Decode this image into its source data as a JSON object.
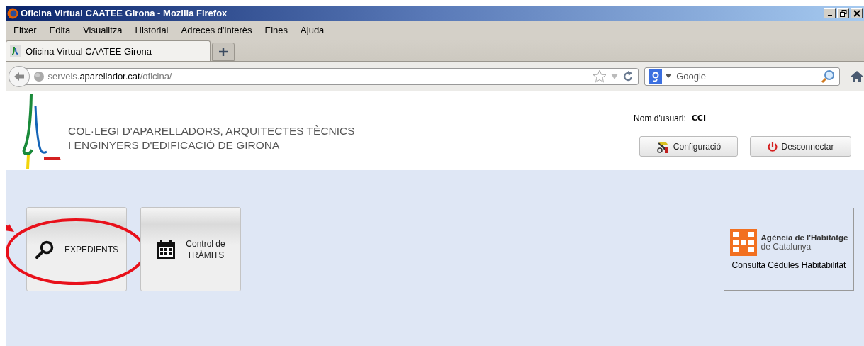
{
  "window": {
    "title": "Oficina Virtual CAATEE Girona - Mozilla Firefox"
  },
  "menu": [
    "Fitxer",
    "Edita",
    "Visualitza",
    "Historial",
    "Adreces d'interès",
    "Eines",
    "Ajuda"
  ],
  "tabs": [
    {
      "label": "Oficina Virtual CAATEE Girona",
      "selected": true
    }
  ],
  "address": {
    "prefix": "serveis.",
    "domain": "aparellador.cat",
    "path": "/oficina/"
  },
  "search": {
    "placeholder": "Google"
  },
  "header": {
    "org_line_1": "COL·LEGI D'APARELLADORS, ARQUITECTES TÈCNICS",
    "org_line_2": "I ENGINYERS D'EDIFICACIÓ DE GIRONA",
    "user_label": "Nom d'usuari:",
    "user_name": "CCI",
    "buttons": [
      {
        "kind": "settings",
        "label": "Configuració"
      },
      {
        "kind": "logout",
        "label": "Desconnectar"
      }
    ]
  },
  "tiles": [
    {
      "kind": "search",
      "lines": [
        "EXPEDIENTS"
      ],
      "highlighted": true
    },
    {
      "kind": "calendar",
      "lines": [
        "Control de",
        "TRÀMITS"
      ],
      "highlighted": false
    }
  ],
  "agency": {
    "name": "Agència de l'Habitatge",
    "subname": "de Catalunya",
    "link": "Consulta Cèdules Habitabilitat"
  }
}
